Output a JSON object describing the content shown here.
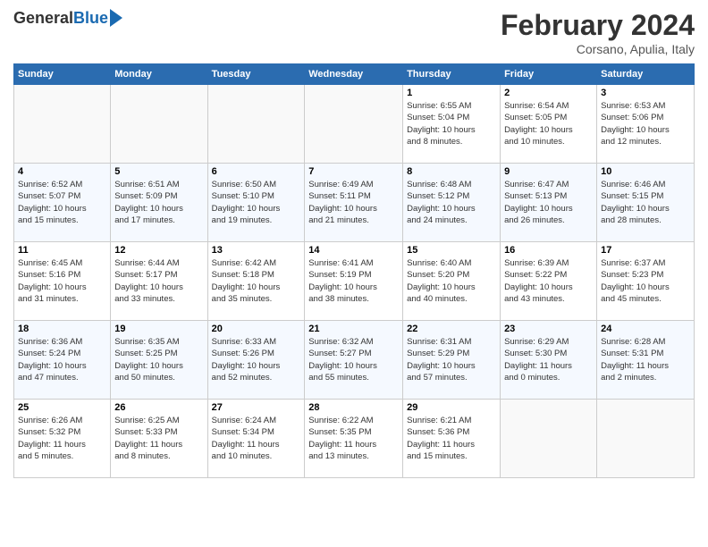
{
  "header": {
    "logo_general": "General",
    "logo_blue": "Blue",
    "month_title": "February 2024",
    "subtitle": "Corsano, Apulia, Italy"
  },
  "days_of_week": [
    "Sunday",
    "Monday",
    "Tuesday",
    "Wednesday",
    "Thursday",
    "Friday",
    "Saturday"
  ],
  "weeks": [
    {
      "days": [
        {
          "num": "",
          "info": ""
        },
        {
          "num": "",
          "info": ""
        },
        {
          "num": "",
          "info": ""
        },
        {
          "num": "",
          "info": ""
        },
        {
          "num": "1",
          "info": "Sunrise: 6:55 AM\nSunset: 5:04 PM\nDaylight: 10 hours\nand 8 minutes."
        },
        {
          "num": "2",
          "info": "Sunrise: 6:54 AM\nSunset: 5:05 PM\nDaylight: 10 hours\nand 10 minutes."
        },
        {
          "num": "3",
          "info": "Sunrise: 6:53 AM\nSunset: 5:06 PM\nDaylight: 10 hours\nand 12 minutes."
        }
      ]
    },
    {
      "days": [
        {
          "num": "4",
          "info": "Sunrise: 6:52 AM\nSunset: 5:07 PM\nDaylight: 10 hours\nand 15 minutes."
        },
        {
          "num": "5",
          "info": "Sunrise: 6:51 AM\nSunset: 5:09 PM\nDaylight: 10 hours\nand 17 minutes."
        },
        {
          "num": "6",
          "info": "Sunrise: 6:50 AM\nSunset: 5:10 PM\nDaylight: 10 hours\nand 19 minutes."
        },
        {
          "num": "7",
          "info": "Sunrise: 6:49 AM\nSunset: 5:11 PM\nDaylight: 10 hours\nand 21 minutes."
        },
        {
          "num": "8",
          "info": "Sunrise: 6:48 AM\nSunset: 5:12 PM\nDaylight: 10 hours\nand 24 minutes."
        },
        {
          "num": "9",
          "info": "Sunrise: 6:47 AM\nSunset: 5:13 PM\nDaylight: 10 hours\nand 26 minutes."
        },
        {
          "num": "10",
          "info": "Sunrise: 6:46 AM\nSunset: 5:15 PM\nDaylight: 10 hours\nand 28 minutes."
        }
      ]
    },
    {
      "days": [
        {
          "num": "11",
          "info": "Sunrise: 6:45 AM\nSunset: 5:16 PM\nDaylight: 10 hours\nand 31 minutes."
        },
        {
          "num": "12",
          "info": "Sunrise: 6:44 AM\nSunset: 5:17 PM\nDaylight: 10 hours\nand 33 minutes."
        },
        {
          "num": "13",
          "info": "Sunrise: 6:42 AM\nSunset: 5:18 PM\nDaylight: 10 hours\nand 35 minutes."
        },
        {
          "num": "14",
          "info": "Sunrise: 6:41 AM\nSunset: 5:19 PM\nDaylight: 10 hours\nand 38 minutes."
        },
        {
          "num": "15",
          "info": "Sunrise: 6:40 AM\nSunset: 5:20 PM\nDaylight: 10 hours\nand 40 minutes."
        },
        {
          "num": "16",
          "info": "Sunrise: 6:39 AM\nSunset: 5:22 PM\nDaylight: 10 hours\nand 43 minutes."
        },
        {
          "num": "17",
          "info": "Sunrise: 6:37 AM\nSunset: 5:23 PM\nDaylight: 10 hours\nand 45 minutes."
        }
      ]
    },
    {
      "days": [
        {
          "num": "18",
          "info": "Sunrise: 6:36 AM\nSunset: 5:24 PM\nDaylight: 10 hours\nand 47 minutes."
        },
        {
          "num": "19",
          "info": "Sunrise: 6:35 AM\nSunset: 5:25 PM\nDaylight: 10 hours\nand 50 minutes."
        },
        {
          "num": "20",
          "info": "Sunrise: 6:33 AM\nSunset: 5:26 PM\nDaylight: 10 hours\nand 52 minutes."
        },
        {
          "num": "21",
          "info": "Sunrise: 6:32 AM\nSunset: 5:27 PM\nDaylight: 10 hours\nand 55 minutes."
        },
        {
          "num": "22",
          "info": "Sunrise: 6:31 AM\nSunset: 5:29 PM\nDaylight: 10 hours\nand 57 minutes."
        },
        {
          "num": "23",
          "info": "Sunrise: 6:29 AM\nSunset: 5:30 PM\nDaylight: 11 hours\nand 0 minutes."
        },
        {
          "num": "24",
          "info": "Sunrise: 6:28 AM\nSunset: 5:31 PM\nDaylight: 11 hours\nand 2 minutes."
        }
      ]
    },
    {
      "days": [
        {
          "num": "25",
          "info": "Sunrise: 6:26 AM\nSunset: 5:32 PM\nDaylight: 11 hours\nand 5 minutes."
        },
        {
          "num": "26",
          "info": "Sunrise: 6:25 AM\nSunset: 5:33 PM\nDaylight: 11 hours\nand 8 minutes."
        },
        {
          "num": "27",
          "info": "Sunrise: 6:24 AM\nSunset: 5:34 PM\nDaylight: 11 hours\nand 10 minutes."
        },
        {
          "num": "28",
          "info": "Sunrise: 6:22 AM\nSunset: 5:35 PM\nDaylight: 11 hours\nand 13 minutes."
        },
        {
          "num": "29",
          "info": "Sunrise: 6:21 AM\nSunset: 5:36 PM\nDaylight: 11 hours\nand 15 minutes."
        },
        {
          "num": "",
          "info": ""
        },
        {
          "num": "",
          "info": ""
        }
      ]
    }
  ]
}
